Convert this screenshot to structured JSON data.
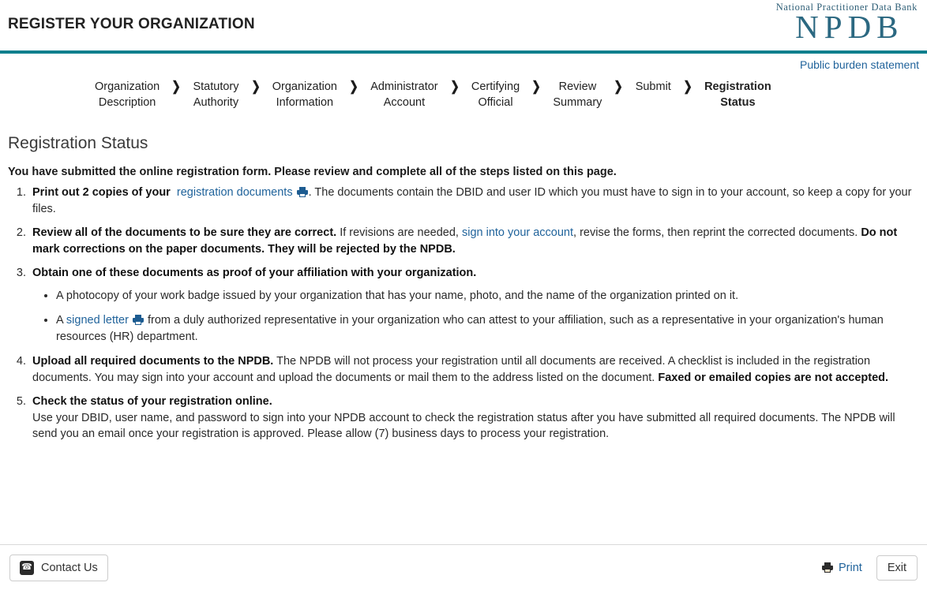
{
  "header": {
    "title": "REGISTER YOUR ORGANIZATION",
    "logo_tagline": "National Practitioner Data Bank",
    "logo_main": "NPDB",
    "rule_color": "#0d7f8d"
  },
  "burden": {
    "link_label": "Public burden statement"
  },
  "steps": [
    {
      "label": "Organization\nDescription",
      "current": false
    },
    {
      "label": "Statutory\nAuthority",
      "current": false
    },
    {
      "label": "Organization\nInformation",
      "current": false
    },
    {
      "label": "Administrator\nAccount",
      "current": false
    },
    {
      "label": "Certifying\nOfficial",
      "current": false
    },
    {
      "label": "Review\nSummary",
      "current": false
    },
    {
      "label": "Submit",
      "current": false
    },
    {
      "label": "Registration\nStatus",
      "current": true
    }
  ],
  "chevron": "❯",
  "main": {
    "section_title": "Registration Status",
    "lead": "You have submitted the online registration form.  Please review and complete all of the steps listed on this page.",
    "item1": {
      "bold_lead": "Print out 2 copies of your",
      "link": "registration documents",
      "rest": ".  The documents contain the DBID and user ID which you must have to sign in to your account, so keep a copy for your files."
    },
    "item2": {
      "bold_lead": "Review all of the documents to be sure they are correct.",
      "text_a": "  If revisions are needed, ",
      "link": "sign into your account",
      "text_b": ", revise the forms, then reprint the corrected documents. ",
      "bold_b": "Do not mark corrections on the paper documents.  They will be rejected by the NPDB.",
      "tail": ""
    },
    "item3": {
      "bold_lead": "Obtain one of these documents as proof of your affiliation with your organization.",
      "bullets": [
        {
          "text_a": "A photocopy of your work badge issued by your organization that has your name, photo, and the name of the organization printed on it.",
          "link": "",
          "text_b": "",
          "has_printer": false
        },
        {
          "text_a": "A ",
          "link": "signed letter",
          "text_b": " from a duly authorized representative in your organization who can attest to your affiliation, such as a representative in your organization's human resources (HR) department.",
          "has_printer": true
        }
      ]
    },
    "item4": {
      "bold_lead": "Upload all required documents to the NPDB.",
      "text_a": "  The NPDB will not process your registration until all documents are received.  A checklist is included in the registration documents.  You may sign into your account and upload the documents or mail them to the address listed on the document.  ",
      "bold_b": "Faxed or emailed copies are not accepted."
    },
    "item5": {
      "bold_lead": "Check the status of your registration online.",
      "text": "Use your DBID, user name, and password to sign into your NPDB account to check the registration status after you have submitted all required documents.  The NPDB will send you an email once your registration is approved.  Please allow (7) business days to process your registration."
    }
  },
  "footer": {
    "contact_label": "Contact Us",
    "phone_glyph": "☎",
    "print_label": "Print",
    "exit_label": "Exit"
  }
}
